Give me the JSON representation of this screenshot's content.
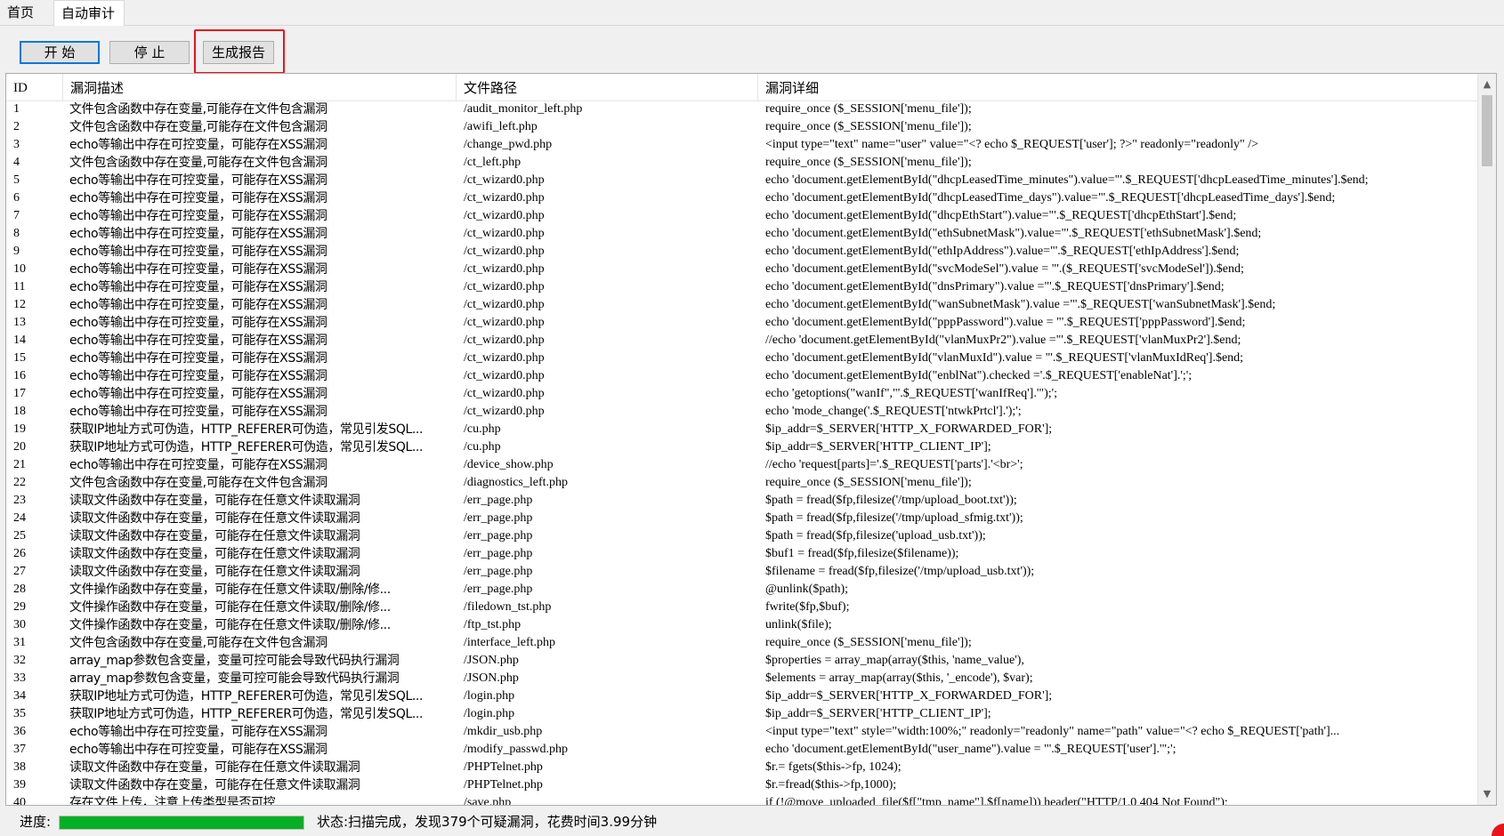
{
  "tabs": [
    "首页",
    "自动审计"
  ],
  "toolbar": {
    "start": "开 始",
    "stop": "停 止",
    "report": "生成报告"
  },
  "table": {
    "columns": [
      "ID",
      "漏洞描述",
      "文件路径",
      "漏洞详细"
    ],
    "rows": [
      [
        "1",
        "文件包含函数中存在变量,可能存在文件包含漏洞",
        "/audit_monitor_left.php",
        "require_once ($_SESSION['menu_file']);"
      ],
      [
        "2",
        "文件包含函数中存在变量,可能存在文件包含漏洞",
        "/awifi_left.php",
        "require_once ($_SESSION['menu_file']);"
      ],
      [
        "3",
        "echo等输出中存在可控变量，可能存在XSS漏洞",
        "/change_pwd.php",
        "<input  type=\"text\" name=\"user\"  value=\"<? echo $_REQUEST['user']; ?>\" readonly=\"readonly\" />"
      ],
      [
        "4",
        "文件包含函数中存在变量,可能存在文件包含漏洞",
        "/ct_left.php",
        "require_once ($_SESSION['menu_file']);"
      ],
      [
        "5",
        "echo等输出中存在可控变量，可能存在XSS漏洞",
        "/ct_wizard0.php",
        "echo 'document.getElementById(\"dhcpLeasedTime_minutes\").value=\"'.$_REQUEST['dhcpLeasedTime_minutes'].$end;"
      ],
      [
        "6",
        "echo等输出中存在可控变量，可能存在XSS漏洞",
        "/ct_wizard0.php",
        "echo 'document.getElementById(\"dhcpLeasedTime_days\").value=\"'.$_REQUEST['dhcpLeasedTime_days'].$end;"
      ],
      [
        "7",
        "echo等输出中存在可控变量，可能存在XSS漏洞",
        "/ct_wizard0.php",
        "echo 'document.getElementById(\"dhcpEthStart\").value=\"'.$_REQUEST['dhcpEthStart'].$end;"
      ],
      [
        "8",
        "echo等输出中存在可控变量，可能存在XSS漏洞",
        "/ct_wizard0.php",
        "echo 'document.getElementById(\"ethSubnetMask\").value=\"'.$_REQUEST['ethSubnetMask'].$end;"
      ],
      [
        "9",
        "echo等输出中存在可控变量，可能存在XSS漏洞",
        "/ct_wizard0.php",
        "echo 'document.getElementById(\"ethIpAddress\").value=\"'.$_REQUEST['ethIpAddress'].$end;"
      ],
      [
        "10",
        "echo等输出中存在可控变量，可能存在XSS漏洞",
        "/ct_wizard0.php",
        "echo 'document.getElementById(\"svcModeSel\").value = \"'.($_REQUEST['svcModeSel']).$end;"
      ],
      [
        "11",
        "echo等输出中存在可控变量，可能存在XSS漏洞",
        "/ct_wizard0.php",
        "echo 'document.getElementById(\"dnsPrimary\").value =\"'.$_REQUEST['dnsPrimary'].$end;"
      ],
      [
        "12",
        "echo等输出中存在可控变量，可能存在XSS漏洞",
        "/ct_wizard0.php",
        "echo 'document.getElementById(\"wanSubnetMask\").value =\"'.$_REQUEST['wanSubnetMask'].$end;"
      ],
      [
        "13",
        "echo等输出中存在可控变量，可能存在XSS漏洞",
        "/ct_wizard0.php",
        "echo 'document.getElementById(\"pppPassword\").value = \"'.$_REQUEST['pppPassword'].$end;"
      ],
      [
        "14",
        "echo等输出中存在可控变量，可能存在XSS漏洞",
        "/ct_wizard0.php",
        "//echo 'document.getElementById(\"vlanMuxPr2\").value =\"'.$_REQUEST['vlanMuxPr2'].$end;"
      ],
      [
        "15",
        "echo等输出中存在可控变量，可能存在XSS漏洞",
        "/ct_wizard0.php",
        "echo 'document.getElementById(\"vlanMuxId\").value = \"'.$_REQUEST['vlanMuxIdReq'].$end;"
      ],
      [
        "16",
        "echo等输出中存在可控变量，可能存在XSS漏洞",
        "/ct_wizard0.php",
        "echo 'document.getElementById(\"enblNat\").checked ='.$_REQUEST['enableNat'].';';"
      ],
      [
        "17",
        "echo等输出中存在可控变量，可能存在XSS漏洞",
        "/ct_wizard0.php",
        "echo 'getoptions(\"wanIf\",\"'.$_REQUEST['wanIfReq'].'\");';"
      ],
      [
        "18",
        "echo等输出中存在可控变量，可能存在XSS漏洞",
        "/ct_wizard0.php",
        "echo 'mode_change('.$_REQUEST['ntwkPrtcl'].');';"
      ],
      [
        "19",
        "获取IP地址方式可伪造，HTTP_REFERER可伪造，常见引发SQL...",
        "/cu.php",
        "$ip_addr=$_SERVER['HTTP_X_FORWARDED_FOR'];"
      ],
      [
        "20",
        "获取IP地址方式可伪造，HTTP_REFERER可伪造，常见引发SQL...",
        "/cu.php",
        "$ip_addr=$_SERVER['HTTP_CLIENT_IP'];"
      ],
      [
        "21",
        "echo等输出中存在可控变量，可能存在XSS漏洞",
        "/device_show.php",
        "//echo 'request[parts]='.$_REQUEST['parts'].'<br>';"
      ],
      [
        "22",
        "文件包含函数中存在变量,可能存在文件包含漏洞",
        "/diagnostics_left.php",
        "require_once ($_SESSION['menu_file']);"
      ],
      [
        "23",
        "读取文件函数中存在变量，可能存在任意文件读取漏洞",
        "/err_page.php",
        "$path = fread($fp,filesize('/tmp/upload_boot.txt'));"
      ],
      [
        "24",
        "读取文件函数中存在变量，可能存在任意文件读取漏洞",
        "/err_page.php",
        "$path = fread($fp,filesize('/tmp/upload_sfmig.txt'));"
      ],
      [
        "25",
        "读取文件函数中存在变量，可能存在任意文件读取漏洞",
        "/err_page.php",
        "$path = fread($fp,filesize('upload_usb.txt'));"
      ],
      [
        "26",
        "读取文件函数中存在变量，可能存在任意文件读取漏洞",
        "/err_page.php",
        "$buf1 = fread($fp,filesize($filename));"
      ],
      [
        "27",
        "读取文件函数中存在变量，可能存在任意文件读取漏洞",
        "/err_page.php",
        "$filename =  fread($fp,filesize('/tmp/upload_usb.txt'));"
      ],
      [
        "28",
        "文件操作函数中存在变量，可能存在任意文件读取/删除/修...",
        "/err_page.php",
        "@unlink($path);"
      ],
      [
        "29",
        "文件操作函数中存在变量，可能存在任意文件读取/删除/修...",
        "/filedown_tst.php",
        "fwrite($fp,$buf);"
      ],
      [
        "30",
        "文件操作函数中存在变量，可能存在任意文件读取/删除/修...",
        "/ftp_tst.php",
        "unlink($file);"
      ],
      [
        "31",
        "文件包含函数中存在变量,可能存在文件包含漏洞",
        "/interface_left.php",
        "require_once ($_SESSION['menu_file']);"
      ],
      [
        "32",
        "array_map参数包含变量，变量可控可能会导致代码执行漏洞",
        "/JSON.php",
        "$properties = array_map(array($this, 'name_value'),"
      ],
      [
        "33",
        "array_map参数包含变量，变量可控可能会导致代码执行漏洞",
        "/JSON.php",
        "$elements = array_map(array($this, '_encode'), $var);"
      ],
      [
        "34",
        "获取IP地址方式可伪造，HTTP_REFERER可伪造，常见引发SQL...",
        "/login.php",
        "$ip_addr=$_SERVER['HTTP_X_FORWARDED_FOR'];"
      ],
      [
        "35",
        "获取IP地址方式可伪造，HTTP_REFERER可伪造，常见引发SQL...",
        "/login.php",
        "$ip_addr=$_SERVER['HTTP_CLIENT_IP'];"
      ],
      [
        "36",
        "echo等输出中存在可控变量，可能存在XSS漏洞",
        "/mkdir_usb.php",
        "<input type=\"text\" style=\"width:100%;\" readonly=\"readonly\" name=\"path\" value=\"<? echo $_REQUEST['path']..."
      ],
      [
        "37",
        "echo等输出中存在可控变量，可能存在XSS漏洞",
        "/modify_passwd.php",
        "echo 'document.getElementById(\"user_name\").value = \"'.$_REQUEST['user'].'\";';"
      ],
      [
        "38",
        "读取文件函数中存在变量，可能存在任意文件读取漏洞",
        "/PHPTelnet.php",
        "$r.= fgets($this->fp, 1024);"
      ],
      [
        "39",
        "读取文件函数中存在变量，可能存在任意文件读取漏洞",
        "/PHPTelnet.php",
        "$r.=fread($this->fp,1000);"
      ],
      [
        "40",
        "存在文件上传，注意上传类型是否可控",
        "/save.php",
        "if (!@move_uploaded_file($f[\"tmp_name\"],$f[name])) header(\"HTTP/1.0 404 Not Found\");"
      ]
    ]
  },
  "status": {
    "progress_label": "进度:",
    "progress_value": 1.0,
    "progress_color": "#06b025",
    "text": "状态:扫描完成，发现379个可疑漏洞，花费时间3.99分钟"
  },
  "colors": {
    "highlight": "#e8141c",
    "focus": "#0078d7"
  },
  "icons": {
    "scroll_up": "chevron-up-icon",
    "scroll_down": "chevron-down-icon"
  }
}
